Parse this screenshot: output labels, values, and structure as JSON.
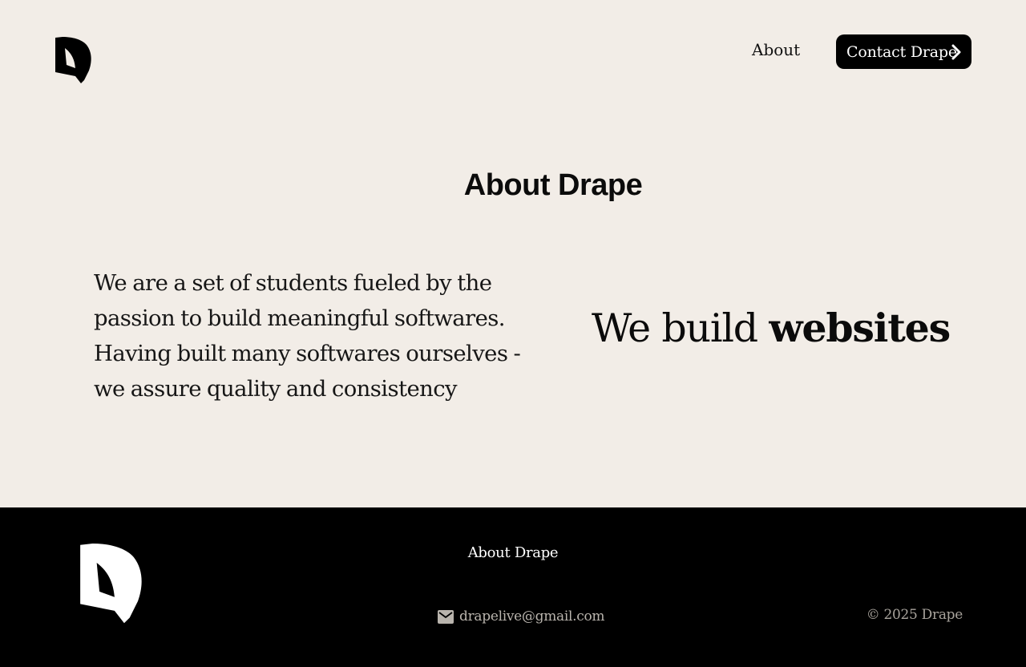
{
  "header": {
    "logo_icon": "drape-logo-icon",
    "nav": {
      "about_label": "About"
    },
    "contact_button": {
      "label": "Contact Drape",
      "icon": "chevron-right-icon"
    }
  },
  "main": {
    "title": "About Drape",
    "description": "We are a set of students fueled by the passion to build meaningful softwares. Having built many softwares ourselves - we assure quality and consistency",
    "tagline": {
      "prefix": "We build",
      "highlight": "websites"
    }
  },
  "footer": {
    "logo_icon": "drape-logo-icon",
    "link_label": "About Drape",
    "email_icon": "mail-icon",
    "email": "drapelive@gmail.com",
    "copyright": "© 2025 Drape"
  },
  "colors": {
    "background": "#f2ede7",
    "footer_background": "#000000",
    "button_background": "#000000",
    "text": "#111111",
    "footer_muted_text": "#b9b4ad"
  }
}
